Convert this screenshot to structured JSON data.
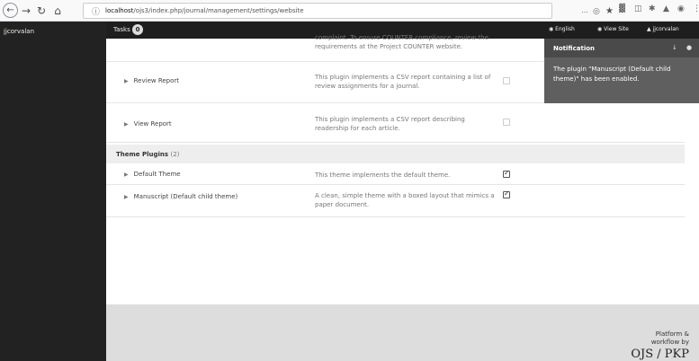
{
  "browser": {
    "url_host": "localhost",
    "url_path": "/ojs3/index.php/journal/management/settings/website",
    "more_icon": "⋯",
    "pocket_icon": "◎",
    "bookmark_icon": "★"
  },
  "sidebar": {
    "username": "jjcorvalan"
  },
  "header": {
    "tasks_label": "Tasks",
    "tasks_count": "0",
    "language_label": "English",
    "view_site_label": "View Site",
    "user_label": "jjcorvalan"
  },
  "plugins": {
    "truncated_desc": "complaint. To ensure COUNTER compliance, review the requirements at the Project COUNTER website.",
    "rows": [
      {
        "name": "Review Report",
        "description": "This plugin implements a CSV report containing a list of review assignments for a journal.",
        "enabled": false
      },
      {
        "name": "View Report",
        "description": "This plugin implements a CSV report describing readership for each article.",
        "enabled": false
      }
    ],
    "theme_section": {
      "label": "Theme Plugins",
      "count": "(2)"
    },
    "theme_rows": [
      {
        "name": "Default Theme",
        "description": "This theme implements the default theme.",
        "enabled": true
      },
      {
        "name": "Manuscript (Default child theme)",
        "description": "A clean, simple theme with a boxed layout that mimics a paper document.",
        "enabled": true
      }
    ]
  },
  "footer": {
    "platform_text": "Platform & workflow by",
    "logo_text": "OJS / PKP"
  },
  "notification": {
    "title": "Notification",
    "message": "The plugin \"Manuscript (Default child theme)\" has been enabled."
  },
  "colors": {
    "header_bg": "#1e1e1e",
    "sidebar_bg": "#222222",
    "notification_bg": "#5f5f5f",
    "section_bg": "#eeeeee",
    "footer_bg": "#dddddd"
  }
}
